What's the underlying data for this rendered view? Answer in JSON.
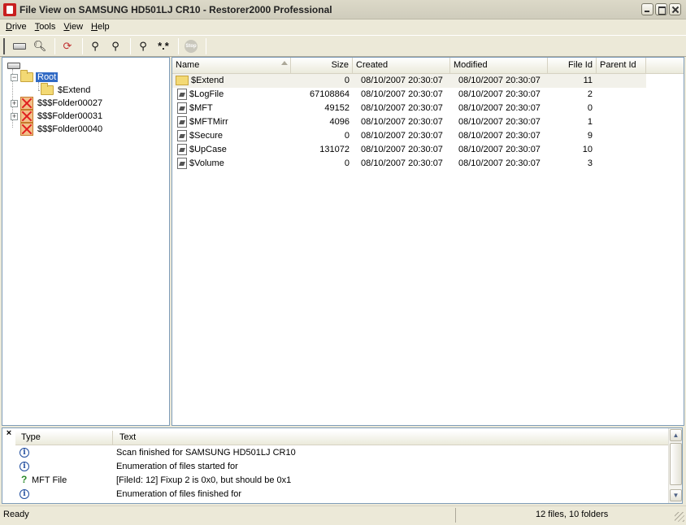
{
  "window": {
    "title": "File View  on SAMSUNG HD501LJ CR10 - Restorer2000 Professional"
  },
  "menu": [
    {
      "u": "D",
      "rest": "rive"
    },
    {
      "u": "T",
      "rest": "ools"
    },
    {
      "u": "V",
      "rest": "iew"
    },
    {
      "u": "H",
      "rest": "elp"
    }
  ],
  "toolbar": {
    "stop_label": "Stop"
  },
  "tree": {
    "root": "Root",
    "children": [
      {
        "label": "$Extend"
      },
      {
        "label": "$$$Folder00027"
      },
      {
        "label": "$$$Folder00031"
      },
      {
        "label": "$$$Folder00040"
      }
    ]
  },
  "list": {
    "columns": [
      "Name",
      "Size",
      "Created",
      "Modified",
      "File Id",
      "Parent Id"
    ],
    "rows": [
      {
        "name": "$Extend",
        "size": "0",
        "created": "08/10/2007 20:30:07",
        "modified": "08/10/2007 20:30:07",
        "file_id": "11",
        "type": "folder"
      },
      {
        "name": "$LogFile",
        "size": "67108864",
        "created": "08/10/2007 20:30:07",
        "modified": "08/10/2007 20:30:07",
        "file_id": "2",
        "type": "file"
      },
      {
        "name": "$MFT",
        "size": "49152",
        "created": "08/10/2007 20:30:07",
        "modified": "08/10/2007 20:30:07",
        "file_id": "0",
        "type": "file"
      },
      {
        "name": "$MFTMirr",
        "size": "4096",
        "created": "08/10/2007 20:30:07",
        "modified": "08/10/2007 20:30:07",
        "file_id": "1",
        "type": "file"
      },
      {
        "name": "$Secure",
        "size": "0",
        "created": "08/10/2007 20:30:07",
        "modified": "08/10/2007 20:30:07",
        "file_id": "9",
        "type": "file"
      },
      {
        "name": "$UpCase",
        "size": "131072",
        "created": "08/10/2007 20:30:07",
        "modified": "08/10/2007 20:30:07",
        "file_id": "10",
        "type": "file"
      },
      {
        "name": "$Volume",
        "size": "0",
        "created": "08/10/2007 20:30:07",
        "modified": "08/10/2007 20:30:07",
        "file_id": "3",
        "type": "file"
      }
    ]
  },
  "log": {
    "close": "×",
    "columns": [
      "Type",
      "Text"
    ],
    "rows": [
      {
        "type": "",
        "icon": "info",
        "text": "Scan finished for SAMSUNG HD501LJ CR10"
      },
      {
        "type": "",
        "icon": "info",
        "text": "Enumeration of files started for"
      },
      {
        "type": "MFT File",
        "icon": "question",
        "text": "[FileId: 12] Fixup 2 is 0x0, but should be 0x1"
      },
      {
        "type": "",
        "icon": "info",
        "text": "Enumeration of files finished for"
      }
    ]
  },
  "status": {
    "left": "Ready",
    "right": "12 files, 10 folders"
  }
}
